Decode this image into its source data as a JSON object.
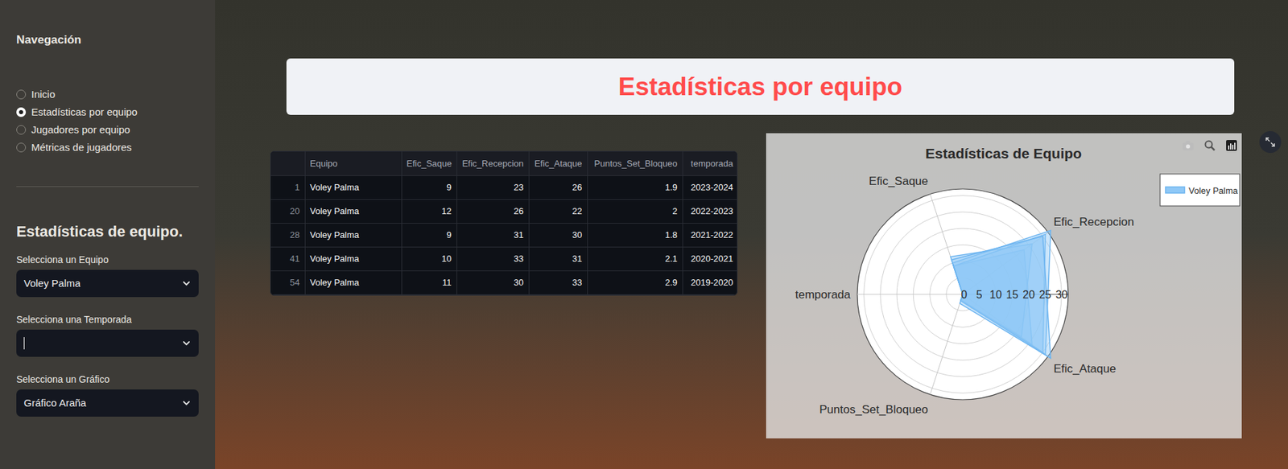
{
  "sidebar": {
    "title": "Navegación",
    "nav": [
      {
        "label": "Inicio",
        "selected": false
      },
      {
        "label": "Estadísticas por equipo",
        "selected": true
      },
      {
        "label": "Jugadores por equipo",
        "selected": false
      },
      {
        "label": "Métricas de jugadores",
        "selected": false
      }
    ],
    "section_title": "Estadísticas de equipo.",
    "fields": [
      {
        "label": "Selecciona un Equipo",
        "value": "Voley Palma",
        "focused": false
      },
      {
        "label": "Selecciona una Temporada",
        "value": "",
        "focused": true
      },
      {
        "label": "Selecciona un Gráfico",
        "value": "Gráfico Araña",
        "focused": false
      }
    ]
  },
  "page_title": "Estadísticas por equipo",
  "table": {
    "columns": [
      "",
      "Equipo",
      "Efic_Saque",
      "Efic_Recepcion",
      "Efic_Ataque",
      "Puntos_Set_Bloqueo",
      "temporada"
    ],
    "rows": [
      [
        "1",
        "Voley Palma",
        "9",
        "23",
        "26",
        "1.9",
        "2023-2024"
      ],
      [
        "20",
        "Voley Palma",
        "12",
        "26",
        "22",
        "2",
        "2022-2023"
      ],
      [
        "28",
        "Voley Palma",
        "9",
        "31",
        "30",
        "1.8",
        "2021-2022"
      ],
      [
        "41",
        "Voley Palma",
        "10",
        "33",
        "31",
        "2.1",
        "2020-2021"
      ],
      [
        "54",
        "Voley Palma",
        "11",
        "30",
        "33",
        "2.9",
        "2019-2020"
      ]
    ]
  },
  "chart": {
    "title": "Estadísticas de Equipo",
    "axes": [
      "Efic_Saque",
      "Efic_Recepcion",
      "Efic_Ataque",
      "Puntos_Set_Bloqueo",
      "temporada"
    ],
    "ticks": [
      "0",
      "5",
      "10",
      "15",
      "20",
      "25",
      "30"
    ],
    "legend": [
      "Voley Palma"
    ],
    "series": [
      {
        "values": [
          9,
          23,
          26,
          1.9,
          0
        ]
      },
      {
        "values": [
          12,
          26,
          22,
          2,
          0
        ]
      },
      {
        "values": [
          9,
          31,
          30,
          1.8,
          0
        ]
      },
      {
        "values": [
          10,
          33,
          31,
          2.1,
          0
        ]
      },
      {
        "values": [
          11,
          30,
          33,
          2.9,
          0
        ]
      }
    ]
  }
}
